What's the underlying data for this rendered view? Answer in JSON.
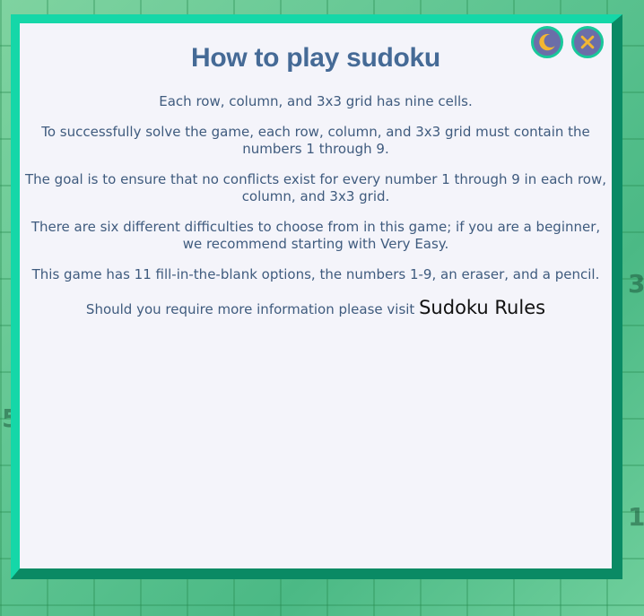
{
  "background": {
    "digits": [
      "3",
      "5",
      "1"
    ]
  },
  "colors": {
    "frame_light": "#15d7a8",
    "frame_dark": "#0a8a64",
    "modal_bg": "#f4f4fa",
    "title": "#456a96",
    "text": "#3f5b7e",
    "icon_button_bg": "#6b6ea8",
    "icon_glyph": "#f2b632"
  },
  "modal": {
    "title": "How to play sudoku",
    "paragraphs": [
      "Each row, column, and 3x3 grid has nine cells.",
      "To successfully solve the game, each row, column, and 3x3 grid must contain the numbers 1 through 9.",
      "The goal is to ensure that no conflicts exist for every number 1 through 9 in each row, column, and 3x3 grid.",
      "There are six different difficulties to choose from in this game; if you are a beginner, we recommend starting with Very Easy.",
      "This game has 11 fill-in-the-blank options, the numbers 1-9, an eraser, and a pencil."
    ],
    "info_text": "Should you require more information please visit",
    "rules_link": "Sudoku Rules"
  },
  "buttons": {
    "theme_icon": "moon-icon",
    "close_icon": "close-icon"
  }
}
